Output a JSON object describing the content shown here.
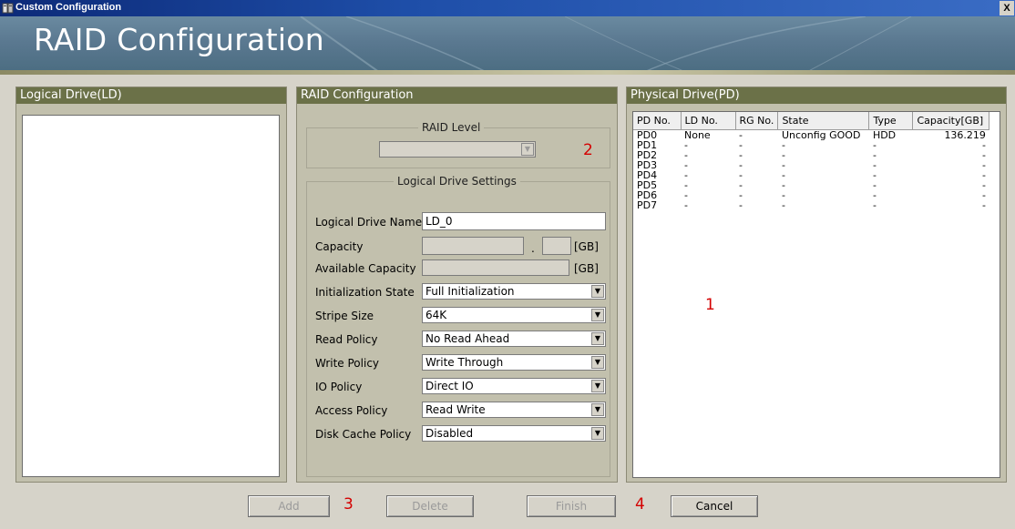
{
  "window": {
    "title": "Custom Configuration",
    "close_glyph": "X"
  },
  "banner": {
    "title": "RAID Configuration"
  },
  "ld_panel": {
    "title": "Logical Drive(LD)"
  },
  "raid_panel": {
    "title": "RAID Configuration",
    "raid_level_group": "RAID Level",
    "raid_level_value": "",
    "ld_settings_group": "Logical Drive Settings",
    "fields": {
      "ld_name_label": "Logical Drive Name",
      "ld_name_value": "LD_0",
      "capacity_label": "Capacity",
      "capacity_int": "",
      "capacity_sep": ".",
      "capacity_frac": "",
      "capacity_unit": "[GB]",
      "avail_label": "Available Capacity",
      "avail_value": "",
      "avail_unit": "[GB]"
    },
    "selects": [
      {
        "label": "Initialization State",
        "value": "Full Initialization"
      },
      {
        "label": "Stripe Size",
        "value": "64K"
      },
      {
        "label": "Read Policy",
        "value": "No Read Ahead"
      },
      {
        "label": "Write Policy",
        "value": "Write Through"
      },
      {
        "label": "IO Policy",
        "value": "Direct IO"
      },
      {
        "label": "Access Policy",
        "value": "Read Write"
      },
      {
        "label": "Disk Cache Policy",
        "value": "Disabled"
      }
    ]
  },
  "pd_panel": {
    "title": "Physical Drive(PD)",
    "columns": [
      "PD No.",
      "LD No.",
      "RG No.",
      "State",
      "Type",
      "Capacity[GB]"
    ],
    "rows": [
      [
        "PD0",
        "None",
        "-",
        "Unconfig GOOD",
        "HDD",
        "136.219"
      ],
      [
        "PD1",
        "-",
        "-",
        "-",
        "-",
        "-"
      ],
      [
        "PD2",
        "-",
        "-",
        "-",
        "-",
        "-"
      ],
      [
        "PD3",
        "-",
        "-",
        "-",
        "-",
        "-"
      ],
      [
        "PD4",
        "-",
        "-",
        "-",
        "-",
        "-"
      ],
      [
        "PD5",
        "-",
        "-",
        "-",
        "-",
        "-"
      ],
      [
        "PD6",
        "-",
        "-",
        "-",
        "-",
        "-"
      ],
      [
        "PD7",
        "-",
        "-",
        "-",
        "-",
        "-"
      ]
    ]
  },
  "buttons": {
    "add": "Add",
    "delete": "Delete",
    "finish": "Finish",
    "cancel": "Cancel"
  },
  "markers": {
    "m1": "1",
    "m2": "2",
    "m3": "3",
    "m4": "4"
  },
  "colors": {
    "title_bar": "#1e4ea8",
    "panel_header": "#6b7148",
    "marker": "#d40000"
  },
  "icons": {
    "app": "app-icon",
    "dropdown": "chevron-down-icon"
  }
}
